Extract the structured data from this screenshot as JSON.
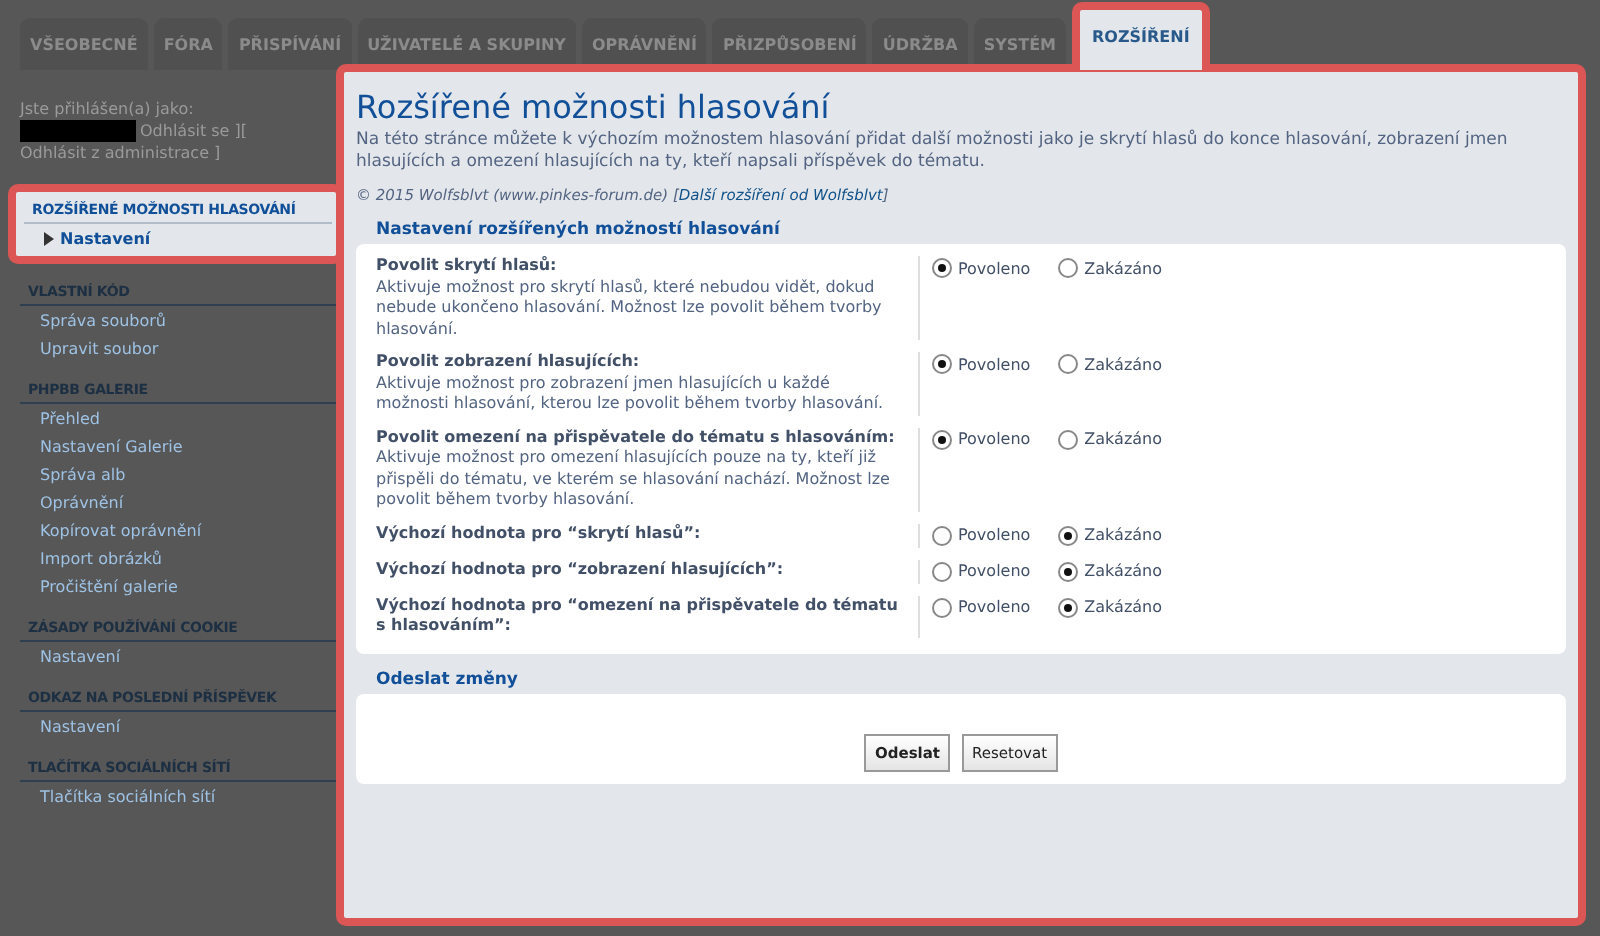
{
  "tabs": [
    {
      "label": "VŠEOBECNÉ",
      "selected": false
    },
    {
      "label": "FÓRA",
      "selected": false
    },
    {
      "label": "PŘISPÍVÁNÍ",
      "selected": false
    },
    {
      "label": "UŽIVATELÉ A SKUPINY",
      "selected": false
    },
    {
      "label": "OPRÁVNĚNÍ",
      "selected": false
    },
    {
      "label": "PŘIZPŮSOBENÍ",
      "selected": false
    },
    {
      "label": "ÚDRŽBA",
      "selected": false
    },
    {
      "label": "SYSTÉM",
      "selected": false
    },
    {
      "label": "ROZŠÍŘENÍ",
      "selected": true
    }
  ],
  "user_block": {
    "label": "Jste přihlášen(a) jako:",
    "links": "Odhlásit se ][ Odhlásit z administrace ]"
  },
  "sidebar": [
    {
      "title": "ROZŠÍŘENÉ MOŽNOSTI HLASOVÁNÍ",
      "highlighted": true,
      "items": [
        {
          "label": "Nastavení",
          "selected": true
        }
      ]
    },
    {
      "title": "VLASTNÍ KÓD",
      "highlighted": false,
      "items": [
        {
          "label": "Správa souborů",
          "selected": false
        },
        {
          "label": "Upravit soubor",
          "selected": false
        }
      ]
    },
    {
      "title": "PHPBB GALERIE",
      "highlighted": false,
      "items": [
        {
          "label": "Přehled",
          "selected": false
        },
        {
          "label": "Nastavení Galerie",
          "selected": false
        },
        {
          "label": "Správa alb",
          "selected": false
        },
        {
          "label": "Oprávnění",
          "selected": false
        },
        {
          "label": "Kopírovat oprávnění",
          "selected": false
        },
        {
          "label": "Import obrázků",
          "selected": false
        },
        {
          "label": "Pročištění galerie",
          "selected": false
        }
      ]
    },
    {
      "title": "ZÁSADY POUŽÍVÁNÍ COOKIE",
      "highlighted": false,
      "items": [
        {
          "label": "Nastavení",
          "selected": false
        }
      ]
    },
    {
      "title": "ODKAZ NA POSLEDNÍ PŘÍSPĚVEK",
      "highlighted": false,
      "items": [
        {
          "label": "Nastavení",
          "selected": false
        }
      ]
    },
    {
      "title": "TLAČÍTKA SOCIÁLNÍCH SÍTÍ",
      "highlighted": false,
      "items": [
        {
          "label": "Tlačítka sociálních sítí",
          "selected": false
        }
      ]
    }
  ],
  "main": {
    "title": "Rozšířené možnosti hlasování",
    "description": "Na této stránce můžete k výchozím možnostem hlasování přidat další možnosti jako je skrytí hlasů do konce hlasování, zobrazení jmen hlasujících a omezení hlasujících na ty, kteří napsali příspěvek do tématu.",
    "copyright": {
      "text": "© 2015 Wolfsblvt (www.pinkes-forum.de) [",
      "link": "Další rozšíření od Wolfsblvt",
      "after": "]"
    },
    "settings": {
      "legend": "Nastavení rozšířených možností hlasování",
      "rows": [
        {
          "label": "Povolit skrytí hlasů:",
          "description": "Aktivuje možnost pro skrytí hlasů, které nebudou vidět, dokud nebude ukončeno hlasování. Možnost lze povolit během tvorby hlasování.",
          "options": [
            {
              "label": "Povoleno",
              "selected": true
            },
            {
              "label": "Zakázáno",
              "selected": false
            }
          ]
        },
        {
          "label": "Povolit zobrazení hlasujících:",
          "description": "Aktivuje možnost pro zobrazení jmen hlasujících u každé možnosti hlasování, kterou lze povolit během tvorby hlasování.",
          "options": [
            {
              "label": "Povoleno",
              "selected": true
            },
            {
              "label": "Zakázáno",
              "selected": false
            }
          ]
        },
        {
          "label": "Povolit omezení na přispěvatele do tématu s hlasováním:",
          "description": "Aktivuje možnost pro omezení hlasujících pouze na ty, kteří již přispěli do tématu, ve kterém se hlasování nachází. Možnost lze povolit během tvorby hlasování.",
          "options": [
            {
              "label": "Povoleno",
              "selected": true
            },
            {
              "label": "Zakázáno",
              "selected": false
            }
          ]
        },
        {
          "label": "Výchozí hodnota pro “skrytí hlasů”:",
          "options": [
            {
              "label": "Povoleno",
              "selected": false
            },
            {
              "label": "Zakázáno",
              "selected": true
            }
          ]
        },
        {
          "label": "Výchozí hodnota pro “zobrazení hlasujících”:",
          "options": [
            {
              "label": "Povoleno",
              "selected": false
            },
            {
              "label": "Zakázáno",
              "selected": true
            }
          ]
        },
        {
          "label": "Výchozí hodnota pro “omezení na přispěvatele do tématu s hlasováním”:",
          "options": [
            {
              "label": "Povoleno",
              "selected": false
            },
            {
              "label": "Zakázáno",
              "selected": true
            }
          ]
        }
      ]
    },
    "submit": {
      "legend": "Odeslat změny",
      "buttons": [
        {
          "label": "Odeslat",
          "kind": "primary"
        },
        {
          "label": "Resetovat",
          "kind": "secondary"
        }
      ]
    }
  }
}
